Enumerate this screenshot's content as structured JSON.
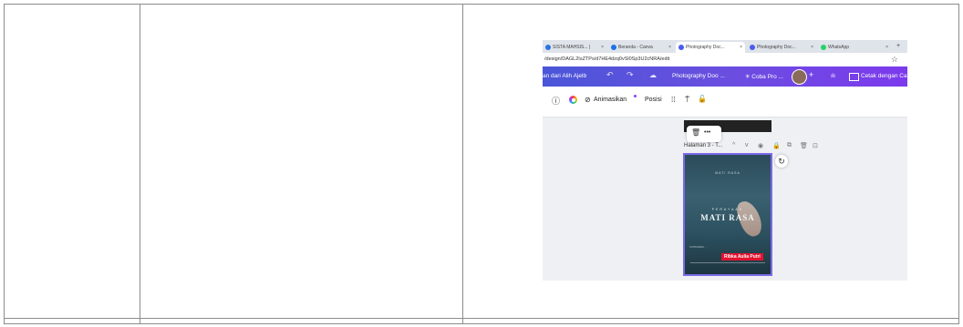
{
  "browser": {
    "tabs": [
      {
        "label": "SISTA MAHSIS... |",
        "fav_color": "#2b74e4",
        "active": false
      },
      {
        "label": "Beranda - Canva",
        "fav_color": "#1a73e8",
        "active": false
      },
      {
        "label": "Photography Doc...",
        "fav_color": "#4a5cf0",
        "active": true
      },
      {
        "label": "Photography Doc...",
        "fav_color": "#4a5cf0",
        "active": false
      },
      {
        "label": "WhatsApp",
        "fav_color": "#25d366",
        "active": false
      }
    ],
    "tab_close": "×",
    "new_tab": "+",
    "url": "/design/DAGL2IsZTPs/d7HE4dzq0vSl0Sp3U2cNRA/edit",
    "bookmark_star": "☆"
  },
  "canva_header": {
    "left_text": "an dari Alih Ajelb",
    "undo": "↶",
    "redo": "↷",
    "cloud": "☁",
    "doc_title": "Photography Doo ...",
    "try_pro": "✳ Coba Pro ...",
    "plus": "+",
    "analytics": "ılı",
    "print_label": "Cetak dengan Ca"
  },
  "toolbar": {
    "info": "ⓘ",
    "animate_label": "Animasikan",
    "position_label": "Posisi",
    "grid_icon": "⁞⁞",
    "paint_icon": "⍑",
    "lock_icon": "🔓"
  },
  "floating": {
    "trash": "🗑",
    "more": "•••"
  },
  "page_header": {
    "label": "Halaman 3 - T...",
    "up": "^",
    "down": "v",
    "icons": [
      "◉",
      "🔒",
      "⧉",
      "🗑",
      "⊡"
    ]
  },
  "poster": {
    "top_text": "MATI RASA",
    "small_title": "PERAYAAN",
    "main_title": "MATI RASA",
    "author_label": "Ribka Aulia Putri",
    "credits": "SUTRADARA ..."
  },
  "refresh_icon": "↻",
  "colors": {
    "canva_purple": "#7c3aed",
    "selection": "#7c6ae8",
    "red_label": "#e3132f"
  }
}
